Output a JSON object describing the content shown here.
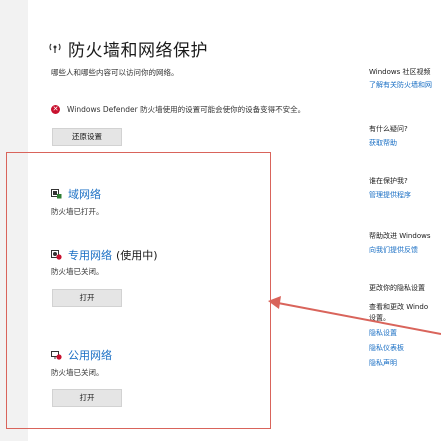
{
  "page": {
    "title": "防火墙和网络保护",
    "subtitle": "哪些人和哪些内容可以访问你的网络。",
    "warning": "Windows Defender 防火墙使用的设置可能会使你的设备变得不安全。",
    "restore_button": "还原设置"
  },
  "networks": [
    {
      "name": "域网络",
      "extra": "",
      "status": "防火墙已打开。",
      "button": ""
    },
    {
      "name": "专用网络",
      "extra": "(使用中)",
      "status": "防火墙已关闭。",
      "button": "打开"
    },
    {
      "name": "公用网络",
      "extra": "",
      "status": "防火墙已关闭。",
      "button": "打开"
    }
  ],
  "right": {
    "community_head": "Windows 社区视频",
    "community_link": "了解有关防火墙和网",
    "question_head": "有什么疑问?",
    "question_link": "获取帮助",
    "protector_head": "谁在保护我?",
    "protector_link": "管理提供程序",
    "improve_head": "帮助改进 Windows",
    "improve_link": "向我们提供反馈",
    "privacy_head": "更改你的隐私设置",
    "privacy_text1": "查看和更改 Windo",
    "privacy_text2": "设置。",
    "privacy_link1": "隐私设置",
    "privacy_link2": "隐私仪表板",
    "privacy_link3": "隐私声明"
  },
  "colors": {
    "accent": "#1a6fc4",
    "warning": "#c8102e",
    "annotation": "#d9645b"
  }
}
